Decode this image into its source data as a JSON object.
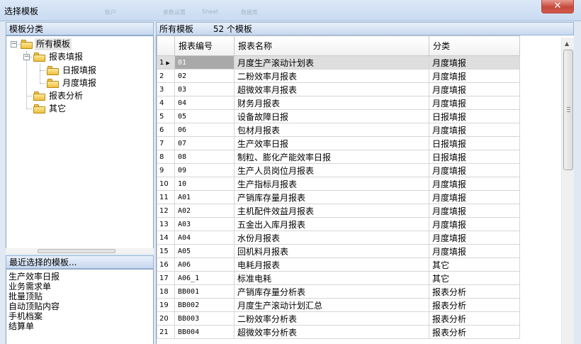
{
  "window": {
    "title": "选择模板",
    "ghost_tabs": [
      "账户",
      "参数设置",
      "Sheet",
      "数据库"
    ]
  },
  "left_panel": {
    "header": "模板分类",
    "tree": [
      {
        "label": "所有模板",
        "level": 0,
        "expanded": true,
        "selected": true
      },
      {
        "label": "报表填报",
        "level": 1,
        "expanded": true
      },
      {
        "label": "日报填报",
        "level": 2
      },
      {
        "label": "月度填报",
        "level": 2
      },
      {
        "label": "报表分析",
        "level": 1
      },
      {
        "label": "其它",
        "level": 1
      }
    ],
    "recent_header": "最近选择的模板...",
    "recent": [
      "生产效率日报",
      "业务需求单",
      "批量顶贴",
      "自动顶贴内容",
      "手机档案",
      "结算单"
    ]
  },
  "right_panel": {
    "header_label": "所有模板",
    "count_text": "52 个模板"
  },
  "table": {
    "columns": [
      "",
      "报表编号",
      "报表名称",
      "分类"
    ],
    "rows": [
      [
        "1",
        "01",
        "月度生产滚动计划表",
        "月度填报"
      ],
      [
        "2",
        "02",
        "二粉效率月报表",
        "月度填报"
      ],
      [
        "3",
        "03",
        "超微效率月报表",
        "月度填报"
      ],
      [
        "4",
        "04",
        "财务月报表",
        "月度填报"
      ],
      [
        "5",
        "05",
        "设备故障日报",
        "日报填报"
      ],
      [
        "6",
        "06",
        "包材月报表",
        "月度填报"
      ],
      [
        "7",
        "07",
        "生产效率日报",
        "日报填报"
      ],
      [
        "8",
        "08",
        "制粒、膨化产能效率日报",
        "日报填报"
      ],
      [
        "9",
        "09",
        "生产人员岗位月报表",
        "月度填报"
      ],
      [
        "10",
        "10",
        "生产指标月报表",
        "月度填报"
      ],
      [
        "11",
        "A01",
        "产销库存量月报表",
        "月度填报"
      ],
      [
        "12",
        "A02",
        "主机配件效益月报表",
        "月度填报"
      ],
      [
        "13",
        "A03",
        "五金出入库月报表",
        "月度填报"
      ],
      [
        "14",
        "A04",
        "水份月报表",
        "月度填报"
      ],
      [
        "15",
        "A05",
        "回机料月报表",
        "月度填报"
      ],
      [
        "16",
        "A06",
        "电耗月报表",
        "其它"
      ],
      [
        "17",
        "A06_1",
        "标准电耗",
        "其它"
      ],
      [
        "18",
        "BB001",
        "产销库存量分析表",
        "报表分析"
      ],
      [
        "19",
        "BB002",
        "月度生产滚动计划汇总",
        "报表分析"
      ],
      [
        "20",
        "BB003",
        "二粉效率分析表",
        "报表分析"
      ],
      [
        "21",
        "BB004",
        "超微效率分析表",
        "报表分析"
      ]
    ],
    "selected_row": 0
  }
}
